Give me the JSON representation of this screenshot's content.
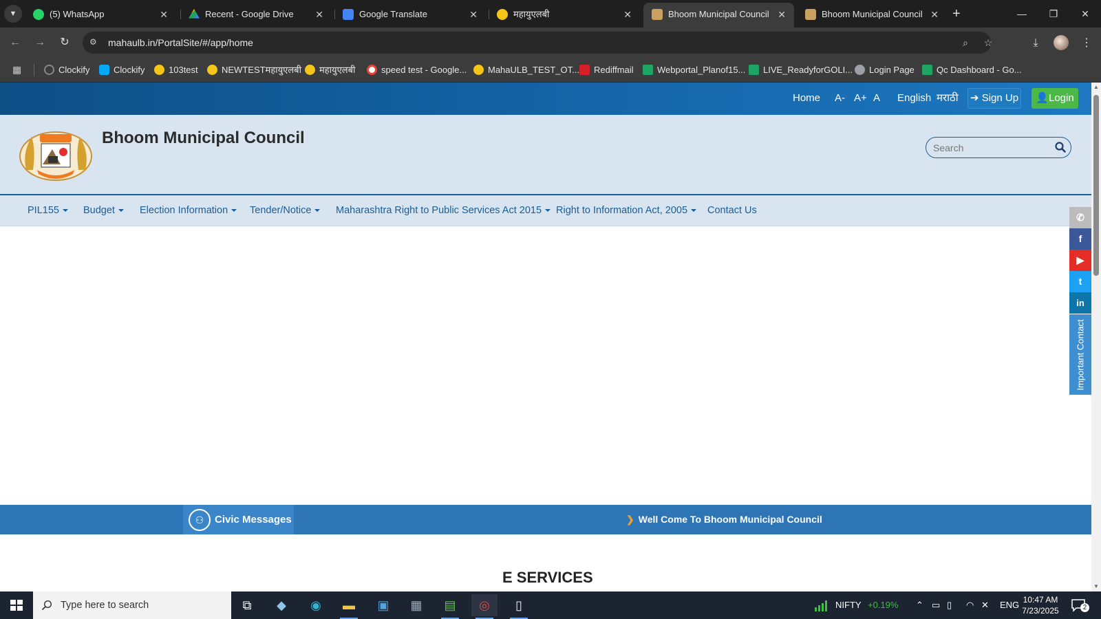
{
  "browser": {
    "tabs": [
      {
        "title": "(5) WhatsApp",
        "favicon_color": "#25d366",
        "active": false
      },
      {
        "title": "Recent - Google Drive",
        "favicon_color": "#1fa463",
        "active": false
      },
      {
        "title": "Google Translate",
        "favicon_color": "#4285f4",
        "active": false
      },
      {
        "title": "महायुएलबी",
        "favicon_color": "#f5c518",
        "active": false
      },
      {
        "title": "Bhoom Municipal Council",
        "favicon_color": "#c9a060",
        "active": true
      },
      {
        "title": "Bhoom Municipal Council",
        "favicon_color": "#c9a060",
        "active": false
      }
    ],
    "new_tab_symbol": "+",
    "url": "mahaulb.in/PortalSite/#/app/home",
    "bookmarks": [
      {
        "label": "Clockify",
        "icon_color": "#888888"
      },
      {
        "label": "Clockify",
        "icon_color": "#03a9f4"
      },
      {
        "label": "103test",
        "icon_color": "#f5c518"
      },
      {
        "label": "NEWTESTमहायुएलबी",
        "icon_color": "#f5c518"
      },
      {
        "label": "महायुएलबी",
        "icon_color": "#f5c518"
      },
      {
        "label": "speed test - Google...",
        "icon_color": "#ffffff"
      },
      {
        "label": "MahaULB_TEST_OT...",
        "icon_color": "#f5c518"
      },
      {
        "label": "Rediffmail",
        "icon_color": "#d42027"
      },
      {
        "label": "Webportal_Planof15...",
        "icon_color": "#1fa463"
      },
      {
        "label": "LIVE_ReadyforGOLI...",
        "icon_color": "#1fa463"
      },
      {
        "label": "Login Page",
        "icon_color": "#9aa0a6"
      },
      {
        "label": "Qc Dashboard - Go...",
        "icon_color": "#1fa463"
      }
    ]
  },
  "site": {
    "topbar": {
      "home": "Home",
      "font_decrease": "A-",
      "font_increase": "A+",
      "font_reset": "A",
      "lang_english": "English",
      "lang_marathi": "मराठी",
      "signup": "Sign Up",
      "login": "Login"
    },
    "title": "Bhoom Municipal Council",
    "search_placeholder": "Search",
    "nav": [
      "PIL155",
      "Budget",
      "Election Information",
      "Tender/Notice",
      "Maharashtra Right to Public Services Act 2015",
      "Right to Information Act, 2005",
      "Contact Us"
    ],
    "important_contact": "Important Contact",
    "civic_messages": "Civic Messages",
    "marquee": "Well Come To Bhoom Municipal Council",
    "eservices_heading": "E SERVICES"
  },
  "taskbar": {
    "search_placeholder": "Type here to search",
    "nifty_label": "NIFTY",
    "nifty_change": "+0.19%",
    "lang": "ENG",
    "time": "10:47 AM",
    "date": "7/23/2025",
    "notifications": "2"
  },
  "colors": {
    "topbar": "#1565a8",
    "header_bg": "#d8e4ef",
    "civic_bar": "#2e75b6",
    "login_green": "#4cb848",
    "nifty_green": "#3fbf3f"
  }
}
